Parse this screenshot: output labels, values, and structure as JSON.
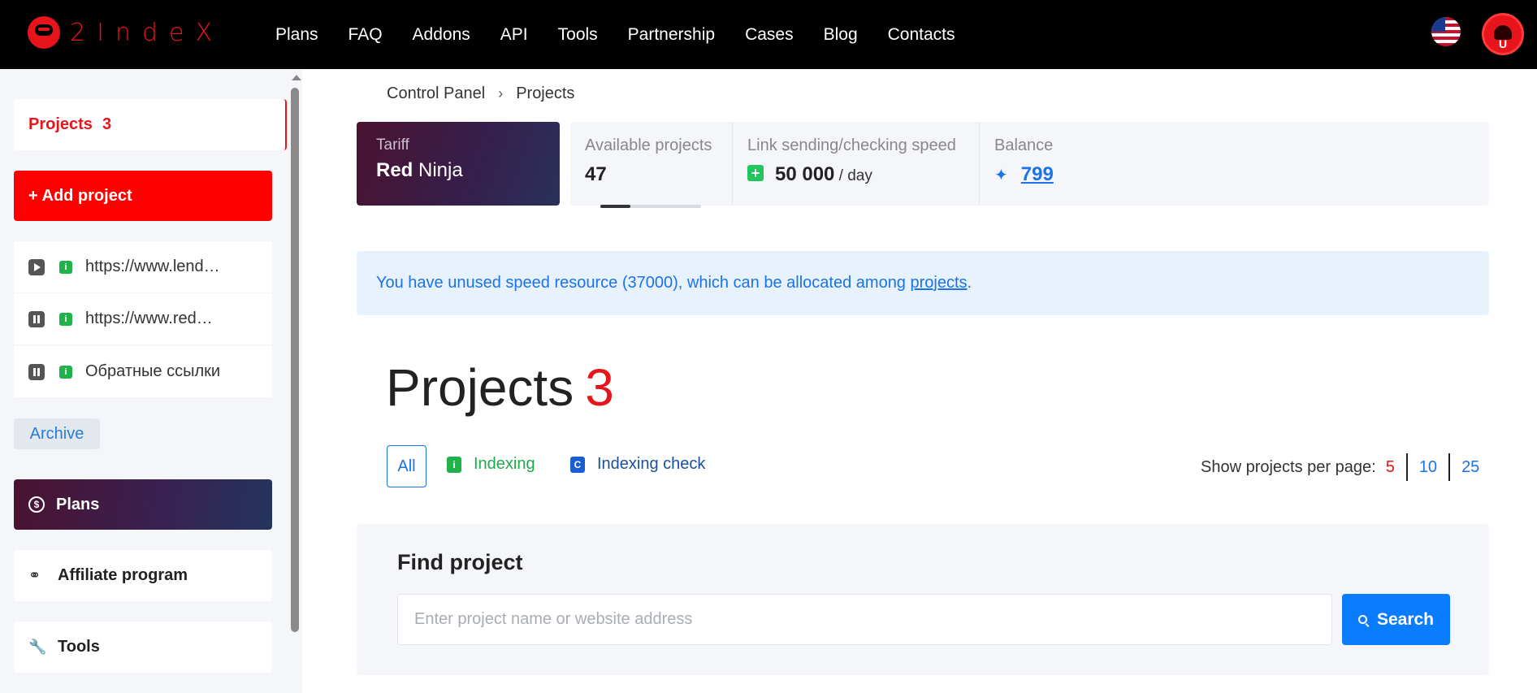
{
  "brand": {
    "logo_text": "2IndeX",
    "accent": "#e8141b"
  },
  "nav": {
    "items": [
      "Plans",
      "FAQ",
      "Addons",
      "API",
      "Tools",
      "Partnership",
      "Cases",
      "Blog",
      "Contacts"
    ]
  },
  "header": {
    "language_icon": "us-flag-icon",
    "avatar_icon": "ninja-avatar-icon"
  },
  "sidebar": {
    "projects_label": "Projects",
    "projects_count": "3",
    "add_project_label": "+ Add project",
    "projects": [
      {
        "status": "play",
        "indicator": "i",
        "name": "https://www.lend…"
      },
      {
        "status": "pause",
        "indicator": "i",
        "name": "https://www.red…"
      },
      {
        "status": "pause",
        "indicator": "i",
        "name": "Обратные ссылки"
      }
    ],
    "archive_label": "Archive",
    "plans_label": "Plans",
    "plans_icon_glyph": "$",
    "affiliate_label": "Affiliate program",
    "tools_label": "Tools"
  },
  "breadcrumb": {
    "root": "Control Panel",
    "separator": "›",
    "current": "Projects"
  },
  "tariff": {
    "label": "Tariff",
    "name_bold": "Red",
    "name_rest": " Ninja"
  },
  "stats": {
    "available_label": "Available projects",
    "available_value": "47",
    "available_progress": 0.3,
    "speed_label": "Link sending/checking speed",
    "speed_plus": "+",
    "speed_value": "50 000",
    "speed_unit": " / day",
    "balance_label": "Balance",
    "balance_value": "799"
  },
  "alert": {
    "text_before": "You have unused speed resource (37000), which can be allocated among ",
    "link_text": "projects",
    "text_after": "."
  },
  "page": {
    "title": "Projects",
    "count": "3"
  },
  "filters": {
    "all_label": "All",
    "indexing_label": "Indexing",
    "indexing_icon_glyph": "i",
    "check_label": "Indexing check",
    "check_icon_glyph": "C"
  },
  "per_page": {
    "label": "Show projects per page:",
    "options": [
      "5",
      "10",
      "25"
    ]
  },
  "find": {
    "title": "Find project",
    "placeholder": "Enter project name or website address",
    "search_label": "Search"
  }
}
